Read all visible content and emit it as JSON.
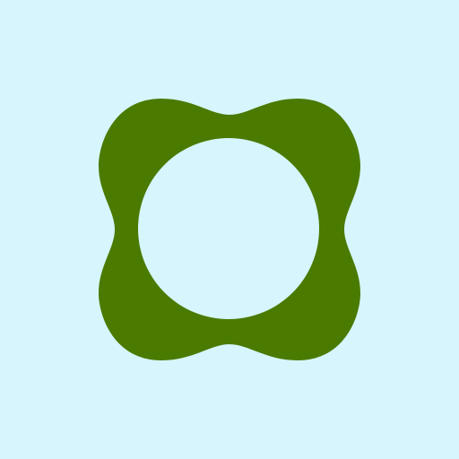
{
  "colors": {
    "background": "#d6f5fd",
    "shape_fill": "#4a7a00",
    "hole_fill": "#d6f5fd"
  },
  "icon": {
    "name": "squircle-ring-icon"
  }
}
